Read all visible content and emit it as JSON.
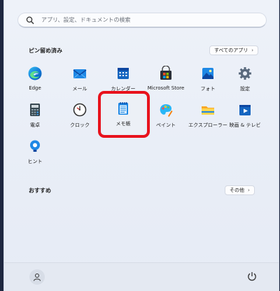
{
  "search": {
    "placeholder": "アプリ、設定、ドキュメントの検索"
  },
  "pinned": {
    "title": "ピン留め済み",
    "all_apps_label": "すべてのアプリ",
    "apps": [
      {
        "label": "Edge",
        "icon": "edge-icon"
      },
      {
        "label": "メール",
        "icon": "mail-icon"
      },
      {
        "label": "カレンダー",
        "icon": "calendar-icon"
      },
      {
        "label": "Microsoft Store",
        "icon": "store-icon"
      },
      {
        "label": "フォト",
        "icon": "photos-icon"
      },
      {
        "label": "設定",
        "icon": "settings-icon"
      },
      {
        "label": "電卓",
        "icon": "calculator-icon"
      },
      {
        "label": "クロック",
        "icon": "clock-icon"
      },
      {
        "label": "メモ帳",
        "icon": "notepad-icon"
      },
      {
        "label": "ペイント",
        "icon": "paint-icon"
      },
      {
        "label": "エクスプローラー",
        "icon": "folder-icon"
      },
      {
        "label": "映画 & テレビ",
        "icon": "movies-tv-icon"
      },
      {
        "label": "ヒント",
        "icon": "tips-icon"
      }
    ]
  },
  "recommended": {
    "title": "おすすめ",
    "more_label": "その他"
  },
  "colors": {
    "highlight": "#e8121c",
    "accent": "#0067c0"
  }
}
